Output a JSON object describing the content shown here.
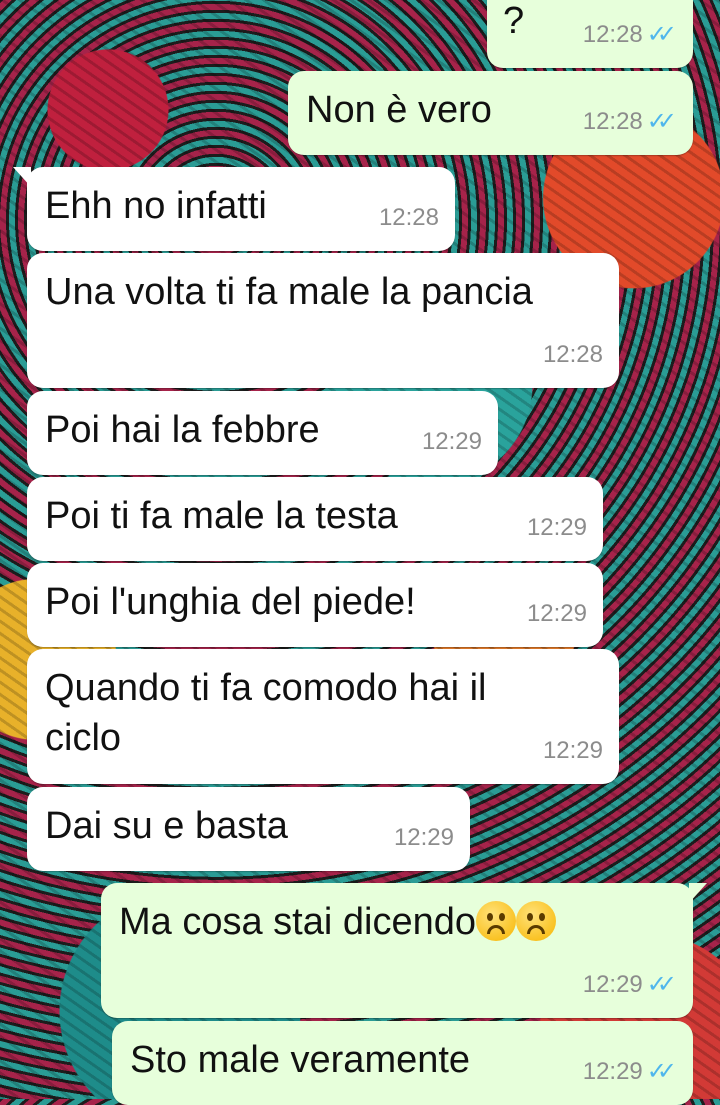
{
  "messages": [
    {
      "id": "m1",
      "dir": "out",
      "text": "?",
      "time": "12:28",
      "ticks": "✓✓"
    },
    {
      "id": "m2",
      "dir": "out",
      "text": "Non è vero",
      "time": "12:28",
      "ticks": "✓✓"
    },
    {
      "id": "m3",
      "dir": "in",
      "text": "Ehh no infatti",
      "time": "12:28"
    },
    {
      "id": "m4",
      "dir": "in",
      "text": "Una volta ti fa male la pancia",
      "time": "12:28"
    },
    {
      "id": "m5",
      "dir": "in",
      "text": "Poi hai la febbre",
      "time": "12:29"
    },
    {
      "id": "m6",
      "dir": "in",
      "text": "Poi ti fa male la testa",
      "time": "12:29"
    },
    {
      "id": "m7",
      "dir": "in",
      "text": "Poi l'unghia del piede!",
      "time": "12:29"
    },
    {
      "id": "m8",
      "dir": "in",
      "text_line1": "Quando ti fa comodo hai il",
      "text_line2": "ciclo",
      "time": "12:29"
    },
    {
      "id": "m9",
      "dir": "in",
      "text": "Dai su e basta",
      "time": "12:29"
    },
    {
      "id": "m10",
      "dir": "out",
      "text": "Ma cosa stai dicendo",
      "emoji": "frowning-face-emoji x2",
      "time": "12:29",
      "ticks": "✓✓"
    },
    {
      "id": "m11",
      "dir": "out",
      "text": "Sto male veramente",
      "time": "12:29",
      "ticks": "✓✓"
    }
  ],
  "colors": {
    "incoming_bubble": "#ffffff",
    "outgoing_bubble": "#e7ffdb",
    "timestamp": "#8c8c8c",
    "read_ticks": "#4fb6ec"
  }
}
